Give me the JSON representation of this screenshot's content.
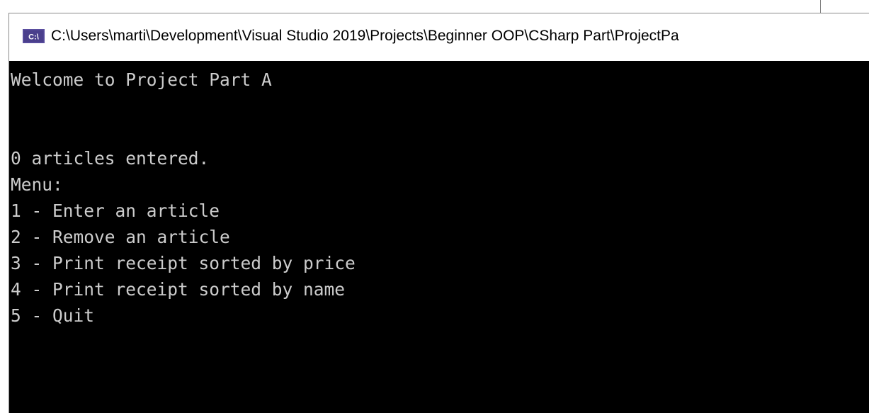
{
  "window": {
    "icon": "console-app-icon",
    "title": "C:\\Users\\marti\\Development\\Visual Studio 2019\\Projects\\Beginner OOP\\CSharp Part\\ProjectPa"
  },
  "console": {
    "lines": [
      "Welcome to Project Part A",
      "",
      "",
      "0 articles entered.",
      "Menu:",
      "1 - Enter an article",
      "2 - Remove an article",
      "3 - Print receipt sorted by price",
      "4 - Print receipt sorted by name",
      "5 - Quit"
    ]
  },
  "colors": {
    "console_background": "#000000",
    "console_text": "#cccccc",
    "titlebar_background": "#ffffff",
    "icon_purple": "#5b4fa0"
  }
}
